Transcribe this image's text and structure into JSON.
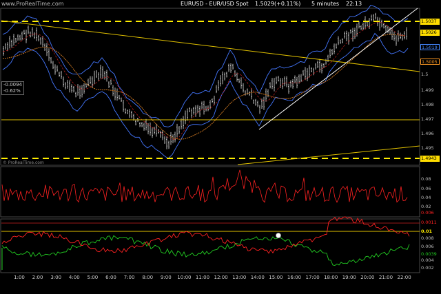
{
  "header": {
    "brand": "www.ProRealTime.com",
    "instrument": "EURUSD - EUR/USD Spot",
    "price": "1.5029",
    "change": "(+0.11%)",
    "timeframe": "5 minutes",
    "clock": "22:13",
    "bottom_brand": "© ProRealTime.com"
  },
  "info_box": {
    "line1": "-0.0094",
    "line2": "-0.62%"
  },
  "price_markers": [
    {
      "label": "1.5037",
      "fg": "#000000",
      "bg": "#ffdd00"
    },
    {
      "label": "1.5026",
      "fg": "#000000",
      "bg": "#ffdd00"
    },
    {
      "label": "1.5019",
      "fg": "#4488ff",
      "bg": "#000000"
    },
    {
      "label": "1.5005",
      "fg": "#ff9922",
      "bg": "#000000"
    },
    {
      "label": "1.4943",
      "fg": "#000000",
      "bg": "#ffdd00"
    }
  ],
  "price_axis": [
    "1.5",
    "1.499",
    "1.498",
    "1.497",
    "1.496",
    "1.495"
  ],
  "volatility_panel": {
    "axis": [
      "0.08",
      "0.06",
      "0.04",
      "0.02"
    ],
    "last_label": "0.006",
    "last_color": "#ff2222"
  },
  "dmi_panel": {
    "axis": [
      "0.01",
      "0.008",
      "0.006",
      "0.004",
      "0.002"
    ],
    "red_label": "0.0011",
    "green_label": "0.0039",
    "yellow_label": "0.01"
  },
  "time_axis": [
    "1:00",
    "2:00",
    "3:00",
    "4:00",
    "5:00",
    "6:00",
    "7:00",
    "8:00",
    "9:00",
    "10:00",
    "11:00",
    "12:00",
    "13:00",
    "14:00",
    "15:00",
    "16:00",
    "17:00",
    "18:00",
    "19:00",
    "20:00",
    "21:00",
    "22:00"
  ],
  "colors": {
    "background": "#000000",
    "candles": "#ffffff",
    "bollinger": "#4477ff",
    "trendline": "#e0c000",
    "dashed_level": "#ffee00",
    "moving_average": "#cc7722",
    "volatility": "#ff2222",
    "dmi_plus": "#22cc22",
    "dmi_minus": "#ff2222"
  }
}
